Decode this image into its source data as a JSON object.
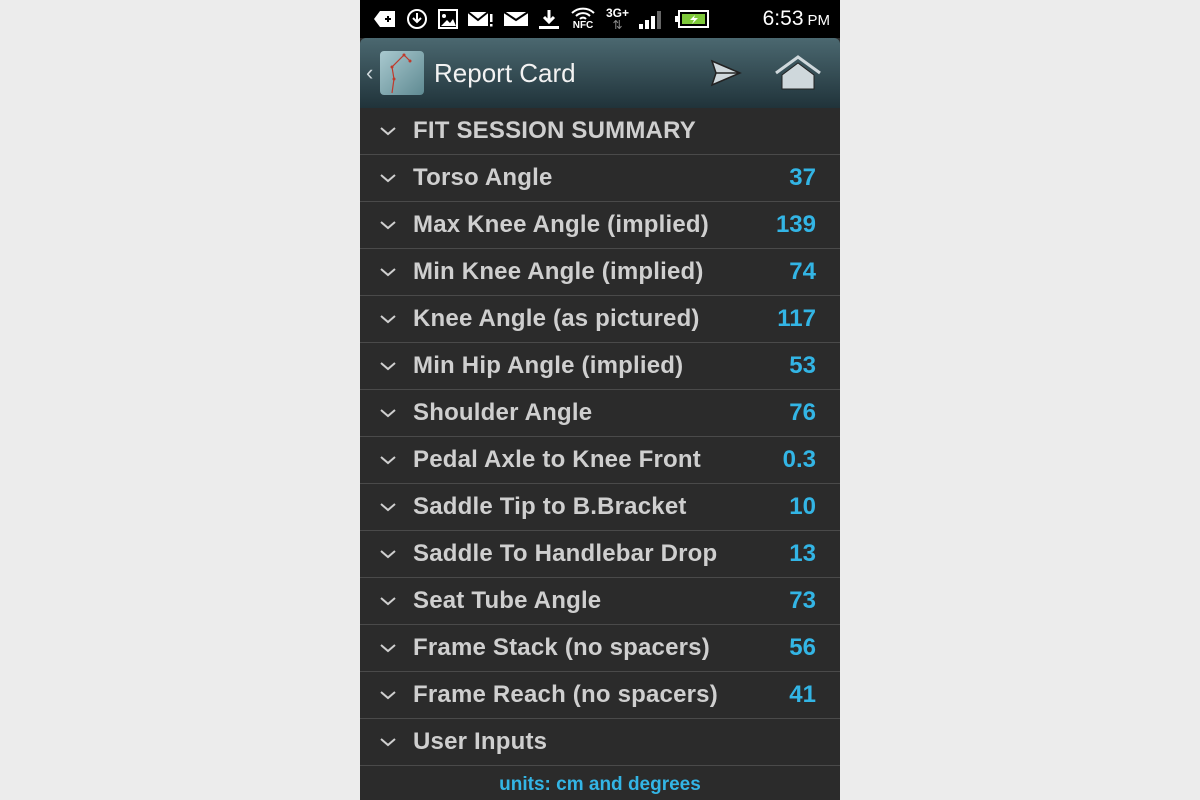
{
  "status_bar": {
    "icons": [
      "back-notification-icon",
      "download-sync-icon",
      "gallery-icon",
      "mail-alert-icon",
      "mail-icon",
      "download-icon",
      "wifi-nfc-icon",
      "3g-plus-data-icon",
      "signal-icon",
      "battery-charging-icon"
    ],
    "network_label": "3G+",
    "nfc_label": "NFC",
    "time": "6:53",
    "ampm": "PM"
  },
  "action_bar": {
    "back_glyph": "‹",
    "title": "Report Card",
    "actions": [
      "send-icon",
      "home-icon"
    ]
  },
  "sections": {
    "summary_header": "FIT SESSION SUMMARY",
    "items": [
      {
        "label": "Torso Angle",
        "value": "37"
      },
      {
        "label": "Max Knee Angle (implied)",
        "value": "139"
      },
      {
        "label": "Min Knee Angle (implied)",
        "value": "74"
      },
      {
        "label": "Knee Angle (as pictured)",
        "value": "117"
      },
      {
        "label": "Min Hip Angle (implied)",
        "value": "53"
      },
      {
        "label": "Shoulder Angle",
        "value": "76"
      },
      {
        "label": "Pedal Axle to Knee Front",
        "value": "0.3"
      },
      {
        "label": "Saddle Tip to B.Bracket",
        "value": "10"
      },
      {
        "label": "Saddle To Handlebar Drop",
        "value": "13"
      },
      {
        "label": "Seat Tube Angle",
        "value": "73"
      },
      {
        "label": "Frame Stack (no spacers)",
        "value": "56"
      },
      {
        "label": "Frame Reach (no spacers)",
        "value": "41"
      }
    ],
    "user_inputs_header": "User Inputs"
  },
  "footer": {
    "units": "units: cm and degrees"
  },
  "colors": {
    "accent": "#33b5e5",
    "background": "#2b2b2b",
    "divider": "#4a4a4a",
    "label": "#cfcfcf"
  }
}
